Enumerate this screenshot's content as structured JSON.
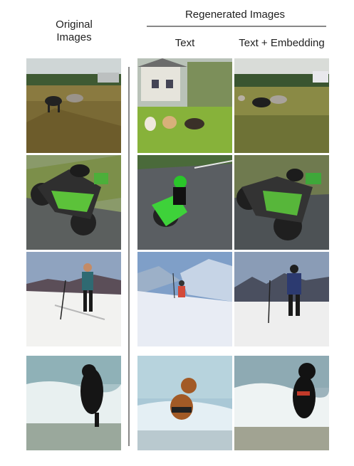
{
  "headers": {
    "original_line1": "Original",
    "original_line2": "Images",
    "regenerated": "Regenerated Images",
    "text": "Text",
    "text_embedding": "Text + Embedding"
  },
  "grid": {
    "rows": [
      "dogs-field",
      "motorcycle",
      "skier",
      "dog-surf"
    ],
    "columns": [
      "original",
      "text",
      "text-embedding"
    ]
  }
}
